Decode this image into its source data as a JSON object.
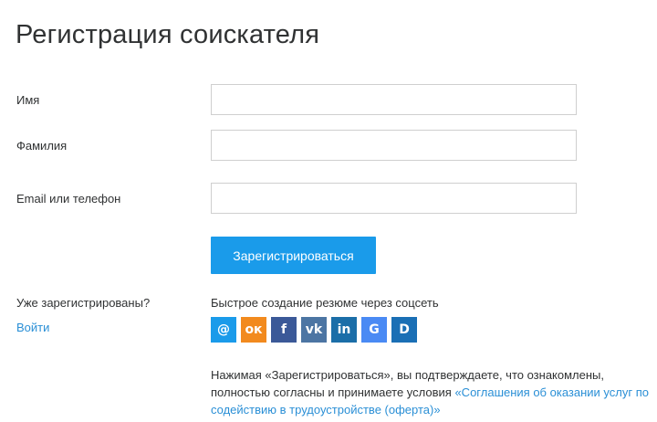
{
  "page": {
    "title": "Регистрация соискателя"
  },
  "form": {
    "first_name": {
      "label": "Имя",
      "value": "",
      "placeholder": ""
    },
    "last_name": {
      "label": "Фамилия",
      "value": "",
      "placeholder": ""
    },
    "login": {
      "label": "Email или телефон",
      "value": "",
      "placeholder": ""
    },
    "submit_label": "Зарегистрироваться"
  },
  "existing": {
    "question": "Уже зарегистрированы?",
    "login_link": "Войти"
  },
  "social": {
    "title": "Быстрое создание резюме через соцсеть",
    "icons": [
      {
        "name": "mail-ru-icon",
        "glyph": "@",
        "color": "#1a9bea"
      },
      {
        "name": "odnoklassniki-icon",
        "glyph": "ок",
        "color": "#f28a1e"
      },
      {
        "name": "facebook-icon",
        "glyph": "f",
        "color": "#3b5998"
      },
      {
        "name": "vkontakte-icon",
        "glyph": "vk",
        "color": "#4c75a3"
      },
      {
        "name": "linkedin-icon",
        "glyph": "in",
        "color": "#1b6ea8"
      },
      {
        "name": "google-icon",
        "glyph": "G",
        "color": "#4a8af4"
      },
      {
        "name": "d-icon",
        "glyph": "D",
        "color": "#1a6fb5"
      }
    ]
  },
  "disclaimer": {
    "text": "Нажимая «Зарегистрироваться», вы подтверждаете, что ознакомлены, полностью согласны и принимаете условия ",
    "link": "«Соглашения об оказании услуг по содействию в трудоустройстве (оферта)»"
  },
  "colors": {
    "accent": "#1a9bea",
    "link": "#2a8fd6",
    "text": "#303233"
  }
}
